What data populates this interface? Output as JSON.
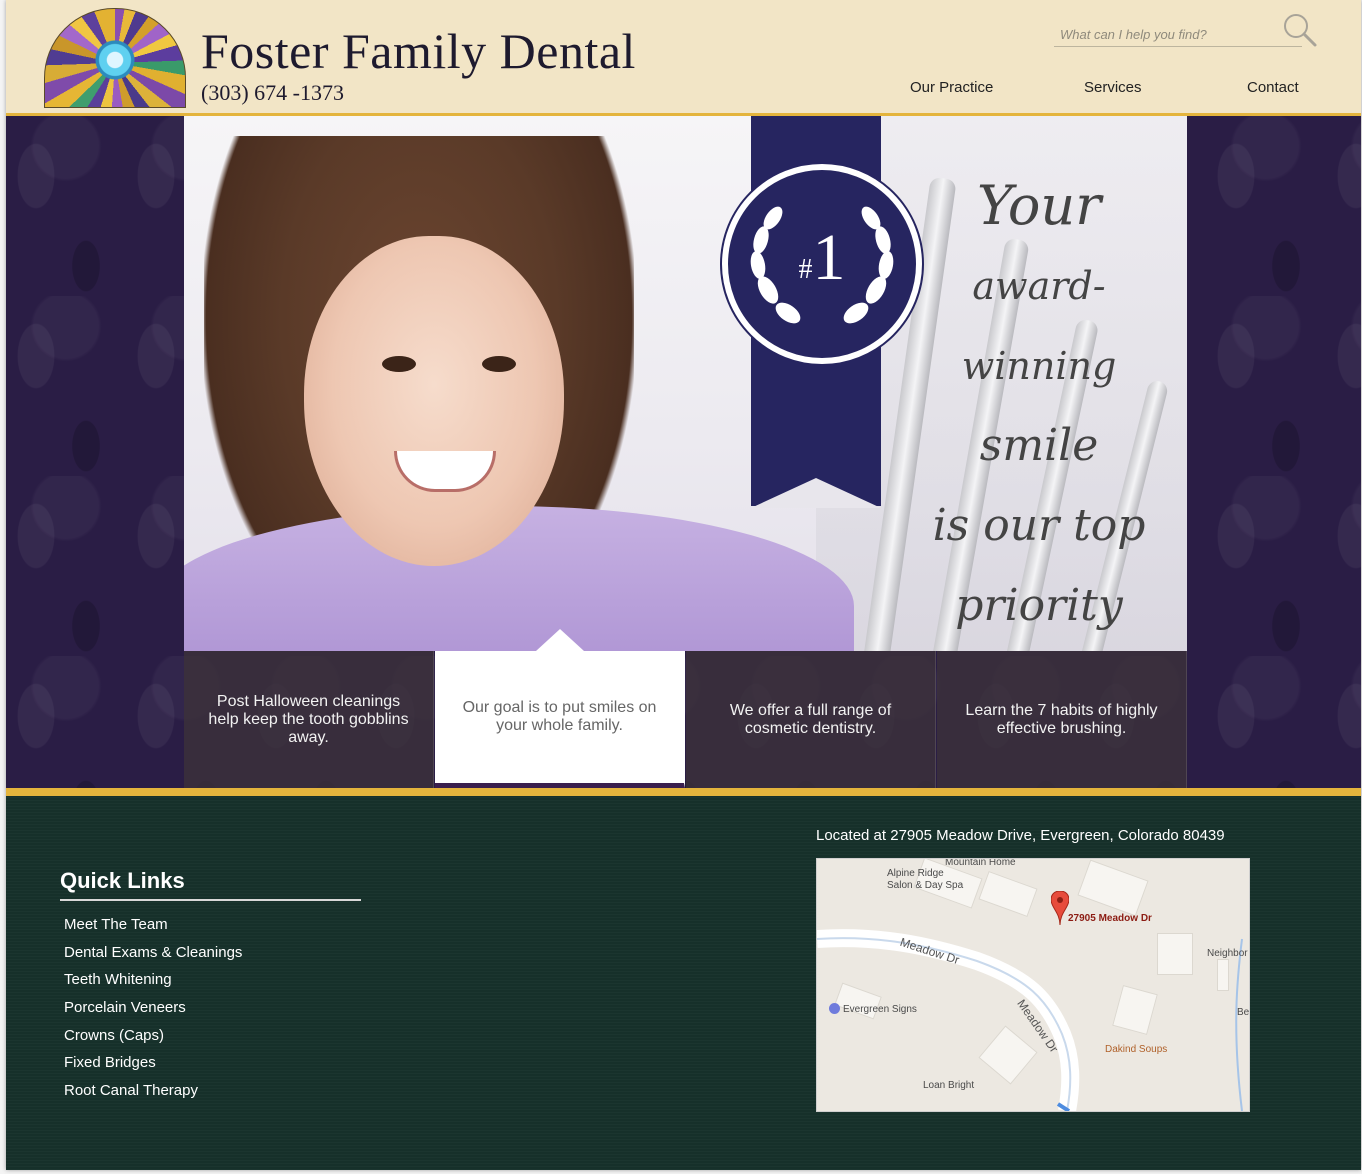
{
  "header": {
    "title": "Foster Family Dental",
    "phone": "(303) 674 -1373",
    "search_placeholder": "What can I help you find?",
    "nav": [
      "Our Practice",
      "Services",
      "Contact"
    ]
  },
  "hero": {
    "award_number": "1",
    "award_hash": "#",
    "tagline": [
      "Your",
      "award-winning",
      "smile",
      "is our top",
      "priority"
    ]
  },
  "features": [
    {
      "text": "Post Halloween cleanings help keep the tooth gobblins away.",
      "active": false
    },
    {
      "text": "Our goal is to put smiles on your whole family.",
      "active": true
    },
    {
      "text": "We offer a full range of cosmetic dentistry.",
      "active": false
    },
    {
      "text": "Learn the 7 habits of highly effective brushing.",
      "active": false
    }
  ],
  "footer": {
    "quick_links_title": "Quick Links",
    "quick_links": [
      "Meet The Team",
      "Dental Exams & Cleanings",
      "Teeth Whitening",
      "Porcelain Veneers",
      "Crowns (Caps)",
      "Fixed Bridges",
      "Root Canal Therapy"
    ],
    "location": "Located at 27905 Meadow Drive, Evergreen, Colorado 80439",
    "map": {
      "pin_label": "27905 Meadow Dr",
      "street_label_1": "Meadow Dr",
      "street_label_2": "Meadow Dr",
      "places": [
        "Mountain Home",
        "Alpine Ridge",
        "Salon & Day Spa",
        "Evergreen Signs",
        "Loan Bright",
        "Dakind Soups",
        "Neighbor",
        "Be"
      ]
    }
  },
  "colors": {
    "header_bg": "#f2e5c6",
    "accent_gold": "#e4b43c",
    "hero_purple": "#2a1d45",
    "ribbon_navy": "#262560",
    "footer_green": "#16302a"
  }
}
